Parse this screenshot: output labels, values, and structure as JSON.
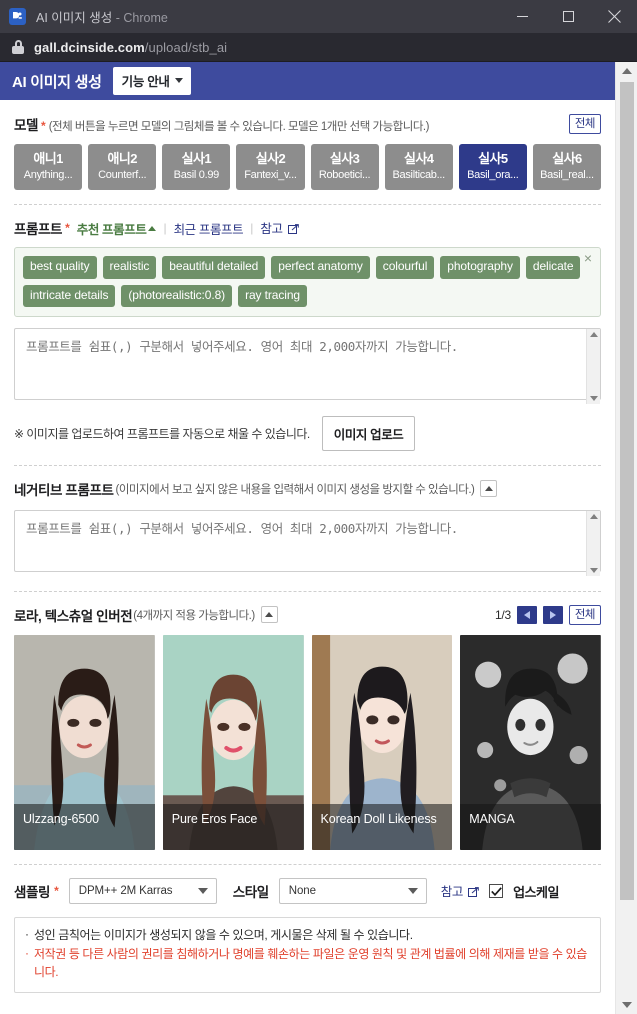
{
  "browser": {
    "tab_title": "AI 이미지 생성",
    "tab_title_suffix": " - Chrome",
    "url_host": "gall.dcinside.com",
    "url_path": "/upload/stb_ai",
    "minimize_label": "최소화",
    "maximize_label": "최대화",
    "close_label": "닫기"
  },
  "app_header": {
    "title": "AI 이미지 생성",
    "guide_button": "기능 안내"
  },
  "model": {
    "label": "모델",
    "required_mark": "*",
    "hint": "(전체 버튼을 누르면 모델의 그림체를 볼 수 있습니다. 모델은 1개만 선택 가능합니다.)",
    "all_button": "전체",
    "selected_index": 6,
    "items": [
      {
        "name": "애니1",
        "sub": "Anything..."
      },
      {
        "name": "애니2",
        "sub": "Counterf..."
      },
      {
        "name": "실사1",
        "sub": "Basil 0.99"
      },
      {
        "name": "실사2",
        "sub": "Fantexi_v..."
      },
      {
        "name": "실사3",
        "sub": "Roboetici..."
      },
      {
        "name": "실사4",
        "sub": "Basilticab..."
      },
      {
        "name": "실사5",
        "sub": "Basil_ora..."
      },
      {
        "name": "실사6",
        "sub": "Basil_real..."
      }
    ]
  },
  "prompt": {
    "label": "프롬프트",
    "required_mark": "*",
    "recommended_link": "추천 프롬프트",
    "recent_link": "최근 프롬프트",
    "reference_link": "참고",
    "separator": "|",
    "close_icon": "×",
    "tags": [
      "best quality",
      "realistic",
      "beautiful detailed",
      "perfect anatomy",
      "colourful",
      "photography",
      "delicate",
      "intricate details",
      "(photorealistic:0.8)",
      "ray tracing"
    ],
    "textarea_value": "",
    "textarea_placeholder": "프롬프트를 쉼표(,) 구분해서 넣어주세요. 영어 최대 2,000자까지 가능합니다.",
    "upload_note": "※ 이미지를 업로드하여 프롬프트를 자동으로 채울 수 있습니다.",
    "upload_button": "이미지 업로드"
  },
  "negative_prompt": {
    "label": "네거티브 프롬프트",
    "hint": "(이미지에서 보고 싶지 않은 내용을 입력해서 이미지 생성을 방지할 수 있습니다.)",
    "textarea_value": "",
    "textarea_placeholder": "프롬프트를 쉼표(,) 구분해서 넣어주세요. 영어 최대 2,000자까지 가능합니다."
  },
  "lora": {
    "label": "로라, 텍스츄얼 인버전",
    "hint": "(4개까지 적용 가능합니다.)",
    "page_indicator": "1/3",
    "prev_label": "이전",
    "next_label": "다음",
    "all_button": "전체",
    "cards": [
      {
        "caption": "Ulzzang-6500"
      },
      {
        "caption": "Pure Eros Face"
      },
      {
        "caption": "Korean Doll Likeness"
      },
      {
        "caption": "MANGA"
      }
    ]
  },
  "sampling": {
    "label": "샘플링",
    "required_mark": "*",
    "sampler_value": "DPM++ 2M Karras",
    "style_label": "스타일",
    "style_value": "None",
    "reference_link": "참고",
    "upscale_label": "업스케일",
    "upscale_checked": true
  },
  "notice": {
    "lines": [
      {
        "text": "성인 금칙어는 이미지가 생성되지 않을 수 있으며, 게시물은 삭제 될 수 있습니다.",
        "tone": "dark"
      },
      {
        "text": "저작권 등 다른 사람의 권리를 침해하거나 명예를 훼손하는 파일은 운영 원칙 및 관계 법률에 의해 제재를 받을 수 있습니다.",
        "tone": "red"
      }
    ]
  },
  "colors": {
    "header_bg": "#3e4b9e",
    "selected_model": "#2e3a8a",
    "tag_green": "#6f9169",
    "required_red": "#e8553d",
    "notice_red": "#e0402c",
    "titlebar": "#3b3b43",
    "urlbar": "#292930"
  }
}
